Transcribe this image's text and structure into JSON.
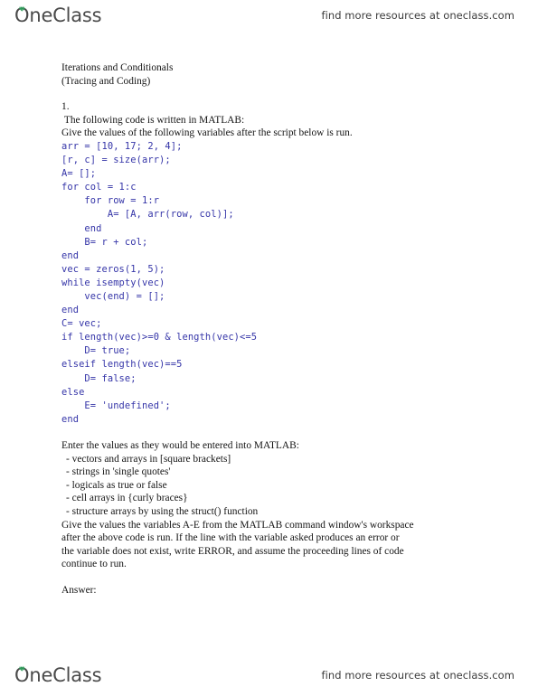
{
  "header": {
    "brand": "OneClass",
    "brand_leaf_color": "#2e9e5b",
    "tagline": "find more resources at oneclass.com"
  },
  "footer": {
    "brand": "OneClass",
    "brand_leaf_color": "#2e9e5b",
    "tagline": "find more resources at oneclass.com"
  },
  "document": {
    "title_line_1": "Iterations and Conditionals",
    "title_line_2": "(Tracing and Coding)",
    "question_number": "1.",
    "intro_line_1": " The following code is written in MATLAB:",
    "intro_line_2": "Give the values of the following variables after the script below is run.",
    "code_color": "#3535a8",
    "code": "arr = [10, 17; 2, 4];\n[r, c] = size(arr);\nA= [];\nfor col = 1:c\n    for row = 1:r\n        A= [A, arr(row, col)];\n    end\n    B= r + col;\nend\nvec = zeros(1, 5);\nwhile isempty(vec)\n    vec(end) = [];\nend\nC= vec;\nif length(vec)>=0 & length(vec)<=5\n    D= true;\nelseif length(vec)==5\n    D= false;\nelse\n    E= 'undefined';\nend",
    "instructions_heading": "Enter the values as they would be entered into MATLAB:",
    "instructions_bullets": [
      "- vectors and arrays in [square brackets]",
      "- strings in 'single quotes'",
      "- logicals as true or false",
      "- cell arrays in {curly braces}",
      "- structure arrays by using the struct() function"
    ],
    "closing_paragraph": "Give the values the variables A-E from the MATLAB command window's workspace\nafter the above code is run. If the line with the variable asked produces an error or\nthe variable does not exist, write ERROR, and assume the proceeding lines of code\ncontinue to run.",
    "answer_label": "Answer:"
  }
}
